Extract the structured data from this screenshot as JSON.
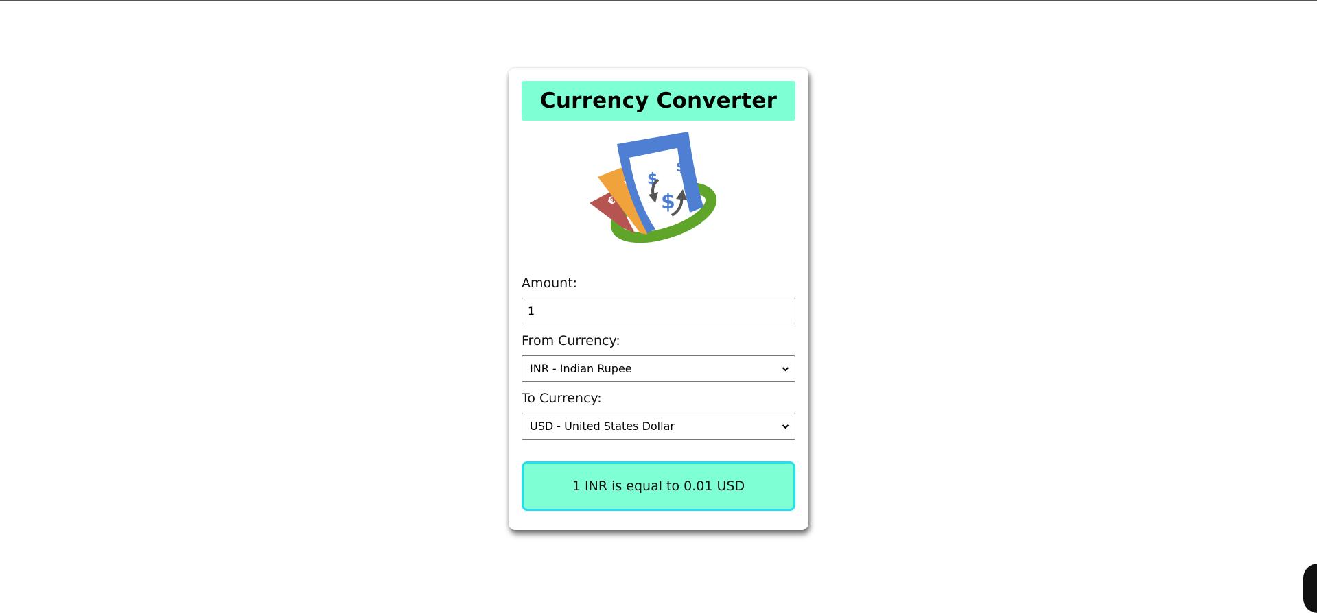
{
  "app": {
    "title": "Currency Converter"
  },
  "logo": {
    "icon": "currency-exchange-logo",
    "colors": {
      "green": "#5ea52a",
      "blue": "#4f7fd2",
      "orange": "#f0a33a",
      "red": "#b55450",
      "arrow": "#555555"
    }
  },
  "form": {
    "amount_label": "Amount:",
    "amount_value": "1",
    "from_label": "From Currency:",
    "from_value": "INR - Indian Rupee",
    "to_label": "To Currency:",
    "to_value": "USD - United States Dollar"
  },
  "result": {
    "text": "1 INR is equal to 0.01 USD"
  },
  "colors": {
    "accent": "#7fffd4",
    "result_border": "#22e0ef"
  }
}
